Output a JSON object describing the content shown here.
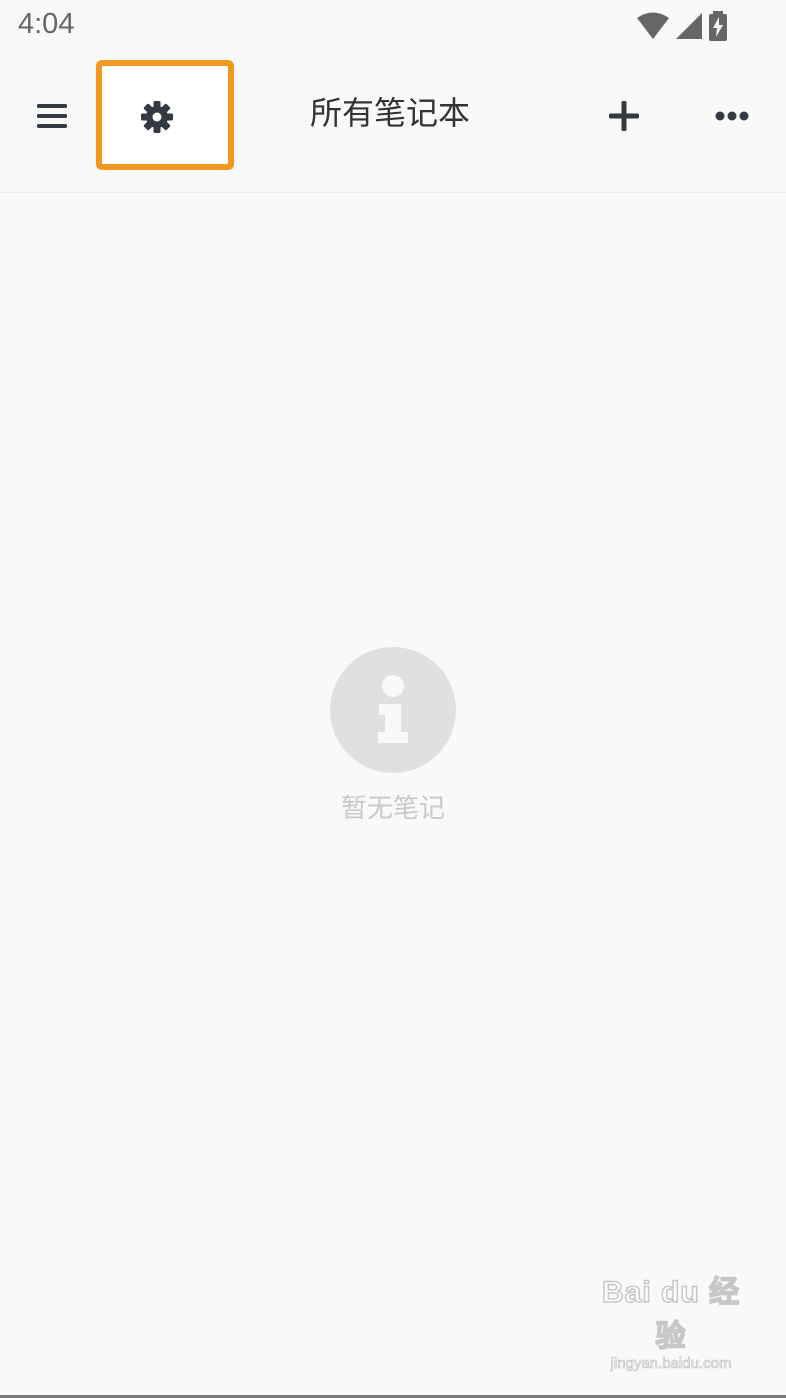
{
  "status_bar": {
    "time": "4:04",
    "icons": [
      "wifi-icon",
      "cellular-signal-icon",
      "battery-charging-icon"
    ]
  },
  "toolbar": {
    "title": "所有笔记本",
    "icons": {
      "menu": "menu-icon",
      "settings": "gear-icon",
      "add": "plus-icon",
      "more": "more-dots-icon"
    },
    "highlight_color": "#f0991e"
  },
  "empty_state": {
    "icon": "info-icon",
    "message": "暂无笔记"
  },
  "watermark": {
    "logo": "Bai du 经验",
    "url": "jingyan.baidu.com"
  },
  "colors": {
    "background": "#f9f9f9",
    "icon_dark": "#333a42",
    "empty_icon_bg": "#e0e0e0"
  }
}
